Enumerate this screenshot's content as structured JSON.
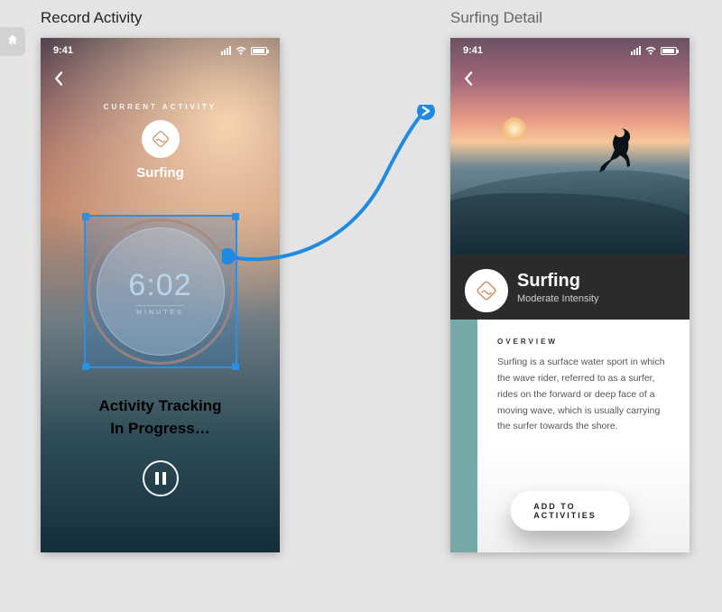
{
  "labels": {
    "left": "Record Activity",
    "right": "Surfing Detail"
  },
  "status": {
    "time": "9:41"
  },
  "left_screen": {
    "kicker": "CURRENT ACTIVITY",
    "activity_name": "Surfing",
    "icon_name": "surf-diamond-icon",
    "timer_value": "6:02",
    "timer_unit": "MINUTES",
    "tracking_line1": "Activity Tracking",
    "tracking_line2": "In Progress…"
  },
  "right_screen": {
    "title": "Surfing",
    "subtitle": "Moderate Intensity",
    "overview_label": "OVERVIEW",
    "overview_body": "Surfing is a surface water sport in which the wave rider, referred to as a surfer, rides on the forward or deep face of a moving wave, which is usually carrying the surfer towards the shore.",
    "cta": "ADD TO ACTIVITIES",
    "icon_name": "surf-diamond-icon"
  },
  "colors": {
    "teal": "#74a9a8",
    "connector": "#1f8ae0",
    "selection": "#2b8fe6",
    "ring": "#d28c64"
  }
}
